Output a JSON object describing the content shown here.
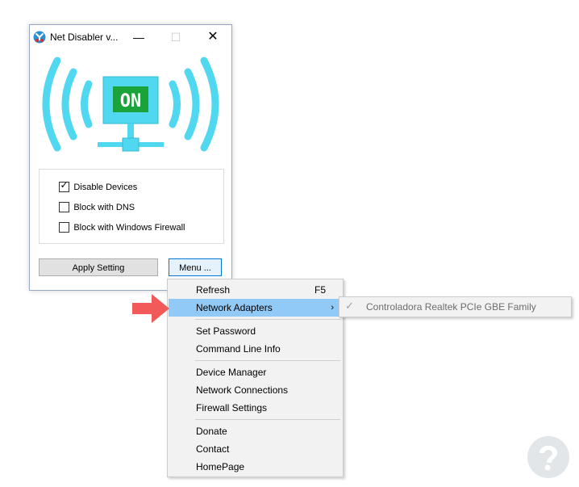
{
  "window": {
    "title": "Net Disabler v...",
    "minimize_glyph": "—",
    "maximize_glyph": "☐",
    "close_glyph": "✕",
    "status_badge": "ON"
  },
  "options": [
    {
      "label": "Disable Devices",
      "checked": true
    },
    {
      "label": "Block with DNS",
      "checked": false
    },
    {
      "label": "Block with Windows Firewall",
      "checked": false
    }
  ],
  "buttons": {
    "apply": "Apply Setting",
    "menu": "Menu ..."
  },
  "menu": {
    "refresh": "Refresh",
    "refresh_shortcut": "F5",
    "network_adapters": "Network Adapters",
    "set_password": "Set Password",
    "command_line_info": "Command Line Info",
    "device_manager": "Device Manager",
    "network_connections": "Network Connections",
    "firewall_settings": "Firewall Settings",
    "donate": "Donate",
    "contact": "Contact",
    "homepage": "HomePage"
  },
  "submenu": {
    "adapter": "Controladora Realtek PCIe GBE Family",
    "checked": true
  },
  "colors": {
    "wifi_waves": "#4fd8f0",
    "monitor": "#4fd8f0",
    "on_badge": "#1aa33a",
    "menu_highlight": "#91c9f7",
    "pointer_arrow": "#f25a5a",
    "watermark": "#d9dde0"
  },
  "icons": {
    "app": "net-disabler-logo-icon",
    "check": "checkmark-icon",
    "submenu_arrow": "chevron-right-icon",
    "pointer": "red-arrow-icon",
    "watermark": "question-mark-watermark-icon"
  }
}
